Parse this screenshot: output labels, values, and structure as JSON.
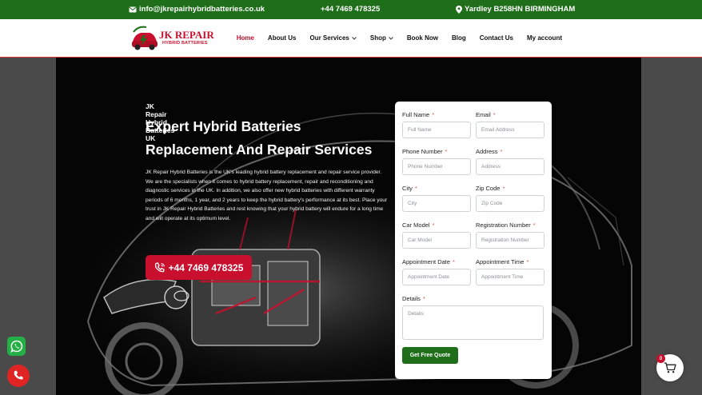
{
  "topbar": {
    "email": "info@jkrepairhybridbatteries.co.uk",
    "phone": "+44 7469 478325",
    "address": "Yardley B258HN BIRMINGHAM"
  },
  "logo": {
    "main": "JK REPAIR",
    "sub": "HYBRID BATTERIES"
  },
  "nav": [
    {
      "label": "Home",
      "active": true
    },
    {
      "label": "About Us"
    },
    {
      "label": "Our Services",
      "dropdown": true
    },
    {
      "label": "Shop",
      "dropdown": true
    },
    {
      "label": "Book Now"
    },
    {
      "label": "Blog"
    },
    {
      "label": "Contact Us"
    },
    {
      "label": "My account"
    }
  ],
  "hero": {
    "eyebrow": "JK Repair Hybrid Batteries UK",
    "title_line1": "Expert Hybrid Batteries",
    "title_line2": "Replacement And Repair Services",
    "paragraph": "JK Repair Hybrid Batteries is the UK's leading hybrid battery replacement and repair service provider. We are the specialists when it comes to hybrid battery replacement, repair and reconditioning and diagnostic services in the UK. In addition, we also offer new hybrid batteries with different warranty periods of 6 months, 1 year, and 2 years to keep the hybrid battery's performance at its best. Place your trust in JK Repair Hybrid Batteries and rest knowing that your hybrid battery will endure for a long time and will operate at its optimum level.",
    "call_label": "+44 7469 478325"
  },
  "form": {
    "required_mark": "*",
    "full_name": {
      "label": "Full Name",
      "placeholder": "Full Name"
    },
    "email": {
      "label": "Email",
      "placeholder": "Email Address"
    },
    "phone": {
      "label": "Phone Number",
      "placeholder": "Phone Number"
    },
    "address": {
      "label": "Address",
      "placeholder": "Address"
    },
    "city": {
      "label": "City",
      "placeholder": "City"
    },
    "zip": {
      "label": "Zip Code",
      "placeholder": "Zip Code"
    },
    "car_model": {
      "label": "Car Model",
      "placeholder": "Car Model"
    },
    "registration": {
      "label": "Registration Number",
      "placeholder": "Registration Number"
    },
    "appt_date": {
      "label": "Appointment Date",
      "placeholder": "Appointment Date"
    },
    "appt_time": {
      "label": "Appointment Time",
      "placeholder": "Appointment Time"
    },
    "details": {
      "label": "Details",
      "placeholder": "Details"
    },
    "submit": "Get Free Quote"
  },
  "cart": {
    "count": "0"
  },
  "icons": {
    "email": "envelope-icon",
    "address": "map-pin-icon",
    "call": "phone-call-icon",
    "whatsapp": "whatsapp-icon",
    "phone_fab": "phone-icon",
    "cart": "cart-icon"
  },
  "colors": {
    "topbar": "#1e6e1a",
    "brand_red": "#c8102e",
    "submit": "#1e6e1a",
    "whatsapp": "#25b047",
    "phone_fab": "#e02424"
  }
}
